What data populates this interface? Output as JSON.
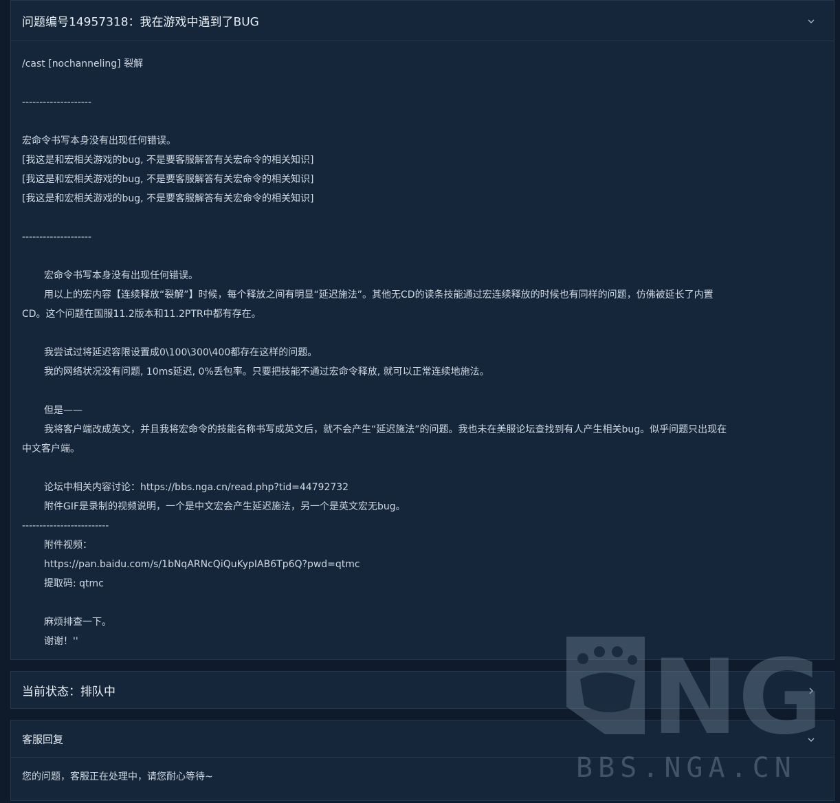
{
  "ticket": {
    "title": "问题编号14957318：我在游戏中遇到了BUG",
    "collapse_icon": "chevron-down-icon",
    "lines": [
      {
        "text": "/cast [nochanneling] 裂解",
        "indent": false
      },
      {
        "text": "",
        "indent": false
      },
      {
        "text": "--------------------",
        "indent": false
      },
      {
        "text": "",
        "indent": false
      },
      {
        "text": "宏命令书写本身没有出现任何错误。",
        "indent": false
      },
      {
        "text": "[我这是和宏相关游戏的bug, 不是要客服解答有关宏命令的相关知识]",
        "indent": false
      },
      {
        "text": "[我这是和宏相关游戏的bug, 不是要客服解答有关宏命令的相关知识]",
        "indent": false
      },
      {
        "text": "[我这是和宏相关游戏的bug, 不是要客服解答有关宏命令的相关知识]",
        "indent": false
      },
      {
        "text": "",
        "indent": false
      },
      {
        "text": "--------------------",
        "indent": false
      },
      {
        "text": "",
        "indent": false
      },
      {
        "text": "宏命令书写本身没有出现任何错误。",
        "indent": true
      },
      {
        "text": "用以上的宏内容【连续释放“裂解”】时候，每个释放之间有明显“延迟施法”。其他无CD的读条技能通过宏连续释放的时候也有同样的问题，仿佛被延长了内置",
        "indent": true
      },
      {
        "text": "CD。这个问题在国服11.2版本和11.2PTR中都有存在。",
        "indent": false
      },
      {
        "text": "",
        "indent": false
      },
      {
        "text": "我尝试过将延迟容限设置成0\\100\\300\\400都存在这样的问题。",
        "indent": true
      },
      {
        "text": "我的网络状况没有问题, 10ms延迟, 0%丢包率。只要把技能不通过宏命令释放, 就可以正常连续地施法。",
        "indent": true
      },
      {
        "text": "",
        "indent": false
      },
      {
        "text": "但是——",
        "indent": true
      },
      {
        "text": "我将客户端改成英文，并且我将宏命令的技能名称书写成英文后，就不会产生“延迟施法”的问题。我也未在美服论坛查找到有人产生相关bug。似乎问题只出现在",
        "indent": true
      },
      {
        "text": "中文客户端。",
        "indent": false
      },
      {
        "text": "",
        "indent": false
      },
      {
        "text": "论坛中相关内容讨论：https://bbs.nga.cn/read.php?tid=44792732",
        "indent": true
      },
      {
        "text": "附件GIF是录制的视频说明，一个是中文宏会产生延迟施法，另一个是英文宏无bug。",
        "indent": true
      },
      {
        "text": "-------------------------",
        "indent": false
      },
      {
        "text": "附件视频：",
        "indent": true
      },
      {
        "text": "https://pan.baidu.com/s/1bNqARNcQiQuKypIAB6Tp6Q?pwd=qtmc",
        "indent": true
      },
      {
        "text": "提取码: qtmc",
        "indent": true
      },
      {
        "text": "",
        "indent": false
      },
      {
        "text": "麻烦排查一下。",
        "indent": true
      },
      {
        "text": "谢谢！''",
        "indent": true
      }
    ]
  },
  "status": {
    "label": "当前状态：排队中",
    "expand_icon": "chevron-right-icon"
  },
  "reply": {
    "title": "客服回复",
    "collapse_icon": "chevron-down-icon",
    "text": "您的问题，客服正在处理中，请您耐心等待~"
  },
  "watermark": {
    "logo_text": "NGA",
    "url_text": "BBS.NGA.CN"
  }
}
